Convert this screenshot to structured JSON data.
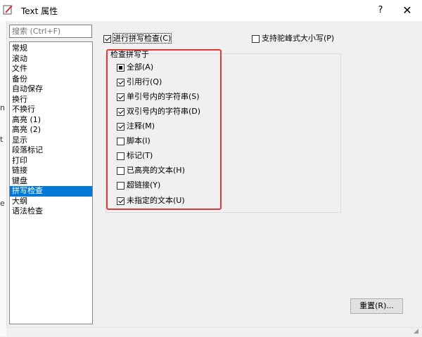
{
  "window": {
    "title": "Text 属性",
    "help": "?",
    "close": "✕"
  },
  "edge_glyphs": [
    "n",
    "t",
    "e"
  ],
  "search": {
    "placeholder": "搜索 (Ctrl+F)"
  },
  "categories": [
    {
      "label": "常规"
    },
    {
      "label": "滚动"
    },
    {
      "label": "文件"
    },
    {
      "label": "备份"
    },
    {
      "label": "自动保存"
    },
    {
      "label": "换行"
    },
    {
      "label": "不换行"
    },
    {
      "label": "高亮 (1)"
    },
    {
      "label": "高亮 (2)"
    },
    {
      "label": "显示"
    },
    {
      "label": "段落标记"
    },
    {
      "label": "打印"
    },
    {
      "label": "链接"
    },
    {
      "label": "键盘"
    },
    {
      "label": "拼写检查",
      "selected": true
    },
    {
      "label": "大纲"
    },
    {
      "label": "语法检查"
    }
  ],
  "options": {
    "enable_spell": {
      "label": "进行拼写检查(C)",
      "checked": true
    },
    "camel_case": {
      "label": "支持驼峰式大小写(P)",
      "checked": false
    }
  },
  "group": {
    "title": "检查拼写于",
    "items": [
      {
        "label": "全部(A)",
        "state": "mixed"
      },
      {
        "label": "引用行(Q)",
        "state": "checked"
      },
      {
        "label": "单引号内的字符串(S)",
        "state": "checked"
      },
      {
        "label": "双引号内的字符串(D)",
        "state": "checked"
      },
      {
        "label": "注释(M)",
        "state": "checked"
      },
      {
        "label": "脚本(I)",
        "state": "unchecked"
      },
      {
        "label": "标记(T)",
        "state": "unchecked"
      },
      {
        "label": "已高亮的文本(H)",
        "state": "unchecked"
      },
      {
        "label": "超链接(Y)",
        "state": "unchecked"
      },
      {
        "label": "未指定的文本(U)",
        "state": "checked"
      }
    ]
  },
  "buttons": {
    "reset": "重置(R)..."
  },
  "colors": {
    "selection": "#0078d7",
    "highlight": "#e53935"
  }
}
